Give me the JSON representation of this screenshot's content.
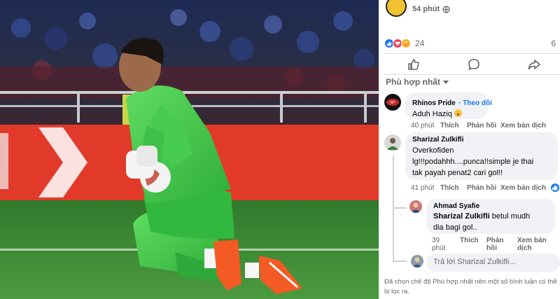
{
  "post": {
    "time": "54 phút",
    "reaction_count": "24",
    "share_count": "6",
    "sort_label": "Phù hợp nhất"
  },
  "reactions": [
    "like-icon",
    "love-icon",
    "care-icon"
  ],
  "comments": [
    {
      "name": "Rhinos Pride",
      "follow": "· Theo dõi",
      "text": "Aduh Haziq",
      "time": "40 phút",
      "like": "Thích",
      "reply": "Phản hồi",
      "translate": "Xem bản dịch"
    },
    {
      "name": "Sharizal Zulkifli",
      "text_lines": [
        "Overkofiden",
        "lg!!!podahhh....punca!!simple je thai",
        "tak payah penat2 cari gol!!"
      ],
      "time": "41 phút",
      "like": "Thích",
      "reply": "Phản hồi",
      "translate": "Xem bản dịch"
    }
  ],
  "reply": {
    "name": "Ahmad Syafie",
    "mention": "Sharizal Zulkifli",
    "text_rest": " betul mudh",
    "text_line2": "dia bagi gol..",
    "time_a": "39",
    "time_b": "phút",
    "like": "Thích",
    "reply_a": "Phản",
    "reply_b": "hồi",
    "translate_a": "Xem bản",
    "translate_b": "dịch"
  },
  "reply_box": {
    "placeholder": "Trả lời Sharizal Zulkifli..."
  },
  "footnote": "Đã chọn chế độ Phù hợp nhất nên một số bình luận có thể bị lọc ra.",
  "colors": {
    "accent": "#1877f2",
    "bubble": "#f0f2f5",
    "muted": "#65676b",
    "jersey": "#3ec24a",
    "pitch": "#3d8a38"
  }
}
